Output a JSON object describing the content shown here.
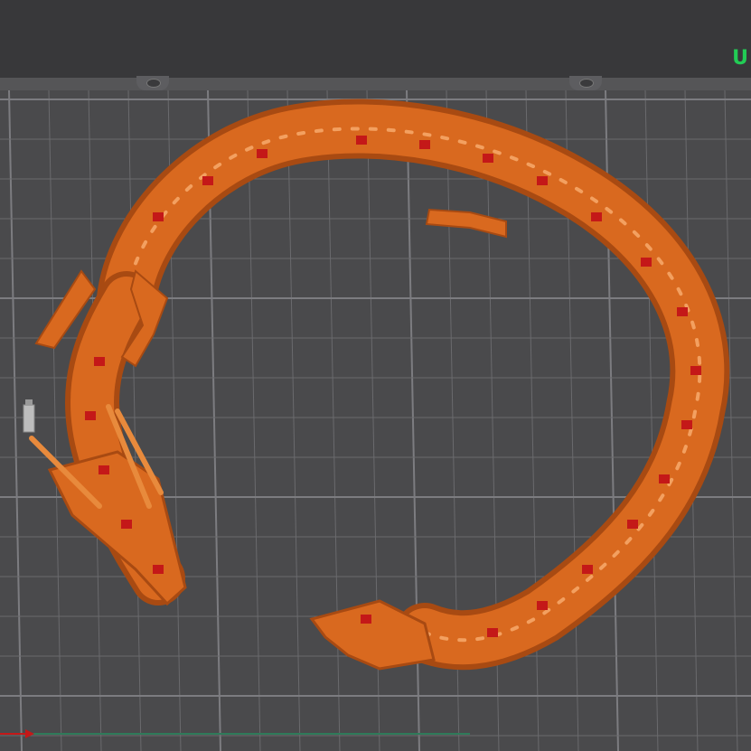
{
  "app": {
    "logo_text": "U"
  },
  "scene": {
    "object": "dragon-model",
    "colors": {
      "background": "#4a4a4c",
      "header": "#38383a",
      "grid_line": "#6a6a6d",
      "grid_major": "#7c7c80",
      "model": "#d9691f",
      "model_dark": "#a84a12",
      "model_highlight": "#f3a060",
      "accent_red": "#c41818",
      "x_axis": "#c41818",
      "y_axis": "#2f7a5a",
      "logo": "#22cc55"
    }
  }
}
